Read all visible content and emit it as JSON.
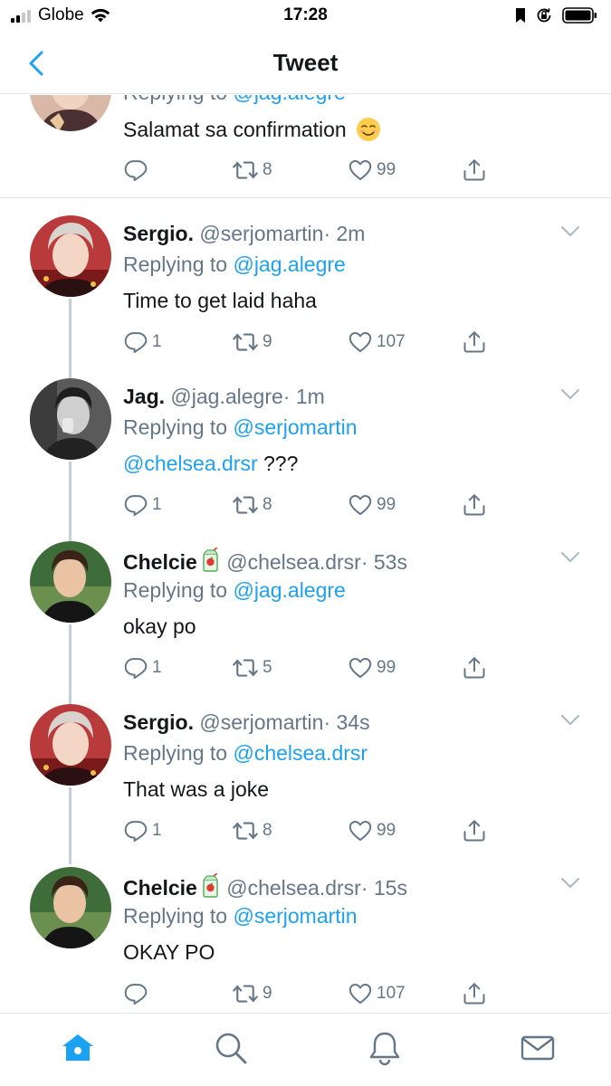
{
  "status_bar": {
    "carrier": "Globe",
    "time": "17:28",
    "icons": [
      "signal-icon",
      "wifi-icon",
      "bookmark-icon",
      "rotation-lock-icon",
      "battery-icon"
    ]
  },
  "nav": {
    "title": "Tweet",
    "back_icon": "chevron-left-icon"
  },
  "colors": {
    "accent": "#1da1f2",
    "secondary_text": "#657786",
    "thread_line": "#c4cfd6"
  },
  "tweets": [
    {
      "replying_prefix": "Replying to",
      "replying_to": "@jag.alegre",
      "text": "Salamat sa confirmation",
      "text_emoji": "smiling-face-emoji",
      "replies": "",
      "retweets": "8",
      "likes": "99"
    },
    {
      "name": "Sergio.",
      "handle": "@serjomartin",
      "time": "· 2m",
      "replying_prefix": "Replying to",
      "replying_to": "@jag.alegre",
      "text": "Time to get laid haha",
      "replies": "1",
      "retweets": "9",
      "likes": "107"
    },
    {
      "name": "Jag.",
      "handle": "@jag.alegre",
      "time": "· 1m",
      "replying_prefix": "Replying to",
      "replying_to": "@serjomartin",
      "text_mention": "@chelsea.drsr",
      "text": "???",
      "replies": "1",
      "retweets": "8",
      "likes": "99"
    },
    {
      "name": "Chelcie",
      "name_emoji": "juice-box-emoji",
      "handle": "@chelsea.drsr",
      "time": "· 53s",
      "replying_prefix": "Replying to",
      "replying_to": "@jag.alegre",
      "text": "okay po",
      "replies": "1",
      "retweets": "5",
      "likes": "99"
    },
    {
      "name": "Sergio.",
      "handle": "@serjomartin",
      "time": "· 34s",
      "replying_prefix": "Replying to",
      "replying_to": "@chelsea.drsr",
      "text": "That was a joke",
      "replies": "1",
      "retweets": "8",
      "likes": "99"
    },
    {
      "name": "Chelcie",
      "name_emoji": "juice-box-emoji",
      "handle": "@chelsea.drsr",
      "time": "· 15s",
      "replying_prefix": "Replying to",
      "replying_to": "@serjomartin",
      "text": "OKAY PO",
      "replies": "",
      "retweets": "9",
      "likes": "107"
    }
  ],
  "tabbar": {
    "tabs": [
      "home-icon",
      "search-icon",
      "notifications-icon",
      "messages-icon"
    ],
    "active": "home-icon"
  }
}
